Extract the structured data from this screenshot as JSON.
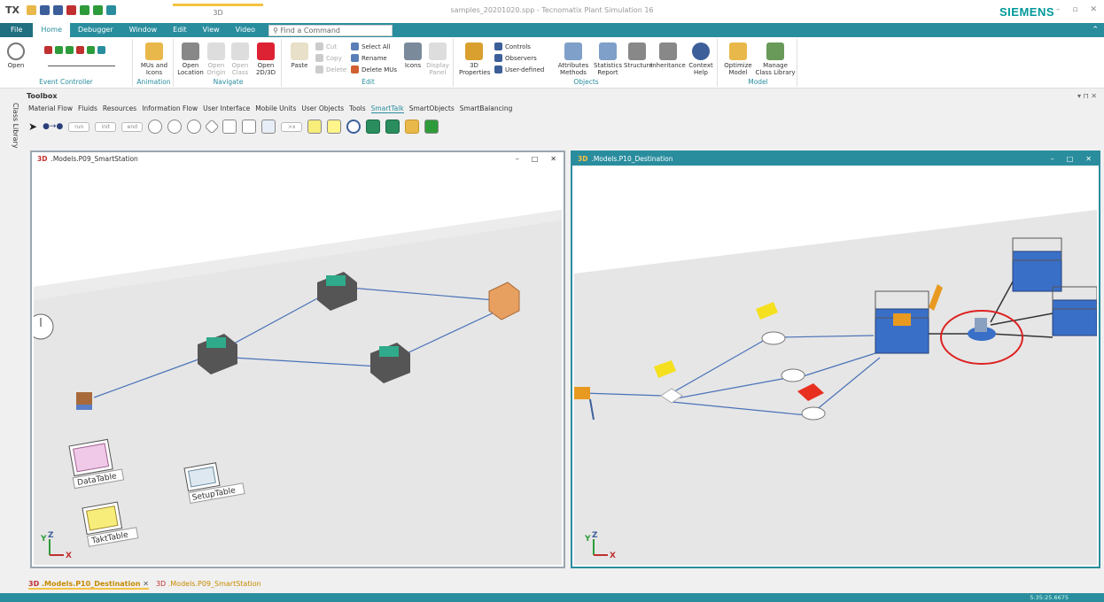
{
  "app": {
    "qat_label": "TX",
    "window_title": "samples_20201020.spp - Tecnomatix Plant Simulation 16",
    "context_tab": "3D",
    "brand": "SIEMENS"
  },
  "tabs": [
    "File",
    "Home",
    "Debugger",
    "Window",
    "Edit",
    "View",
    "Video"
  ],
  "search": {
    "placeholder": "Find a Command"
  },
  "ribbon": {
    "event_controller": {
      "label": "Event Controller",
      "open": "Open"
    },
    "animation": {
      "label": "Animation",
      "mus": "MUs and Icons"
    },
    "navigate": {
      "label": "Navigate",
      "open_location": "Open Location",
      "open_origin": "Open Origin",
      "open_class": "Open Class",
      "open_2d3d": "Open 2D/3D"
    },
    "edit": {
      "label": "Edit",
      "paste": "Paste",
      "cut": "Cut",
      "copy": "Copy",
      "delete": "Delete",
      "select_all": "Select All",
      "rename": "Rename",
      "delete_mus": "Delete MUs",
      "icons": "Icons",
      "display_panel": "Display Panel"
    },
    "objects": {
      "label": "Objects",
      "properties": "3D Properties",
      "controls": "Controls",
      "observers": "Observers",
      "user_defined": "User-defined",
      "attributes": "Attributes Methods",
      "statistics": "Statistics Report",
      "structure": "Structure",
      "inheritance": "Inheritance",
      "context_help": "Context Help"
    },
    "model": {
      "label": "Model",
      "optimize": "Optimize Model",
      "manage": "Manage Class Library"
    }
  },
  "toolbox": {
    "title": "Toolbox",
    "class_library": "Class Library",
    "tabs": [
      "Material Flow",
      "Fluids",
      "Resources",
      "Information Flow",
      "User Interface",
      "Mobile Units",
      "User Objects",
      "Tools",
      "SmartTalk",
      "SmartObjects",
      "SmartBalancing"
    ],
    "active_tab": "SmartTalk"
  },
  "windows": {
    "left": {
      "title": ".Models.P09_SmartStation",
      "labels": {
        "datatable": "DataTable",
        "takttable": "TaktTable",
        "setuptable": "SetupTable"
      }
    },
    "right": {
      "title": ".Models.P10_Destination"
    }
  },
  "axes": {
    "y": "Y",
    "z": "Z",
    "x": "X"
  },
  "bottom_tabs": [
    ".Models.P10_Destination",
    ".Models.P09_SmartStation"
  ],
  "status": {
    "time": "5:35:25.6675"
  }
}
